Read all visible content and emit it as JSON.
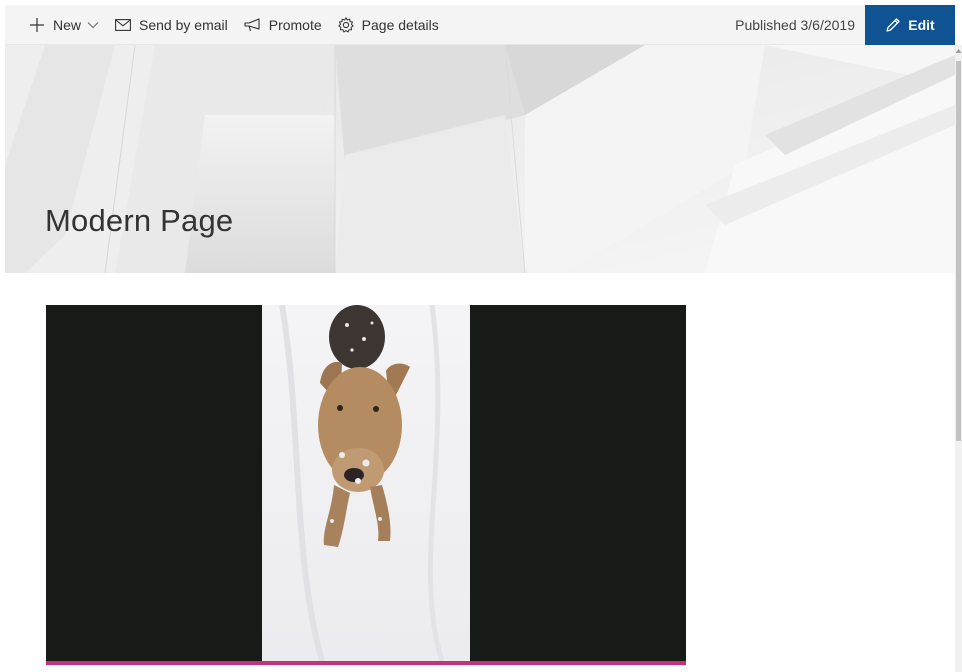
{
  "command_bar": {
    "new_label": "New",
    "send_email_label": "Send by email",
    "promote_label": "Promote",
    "page_details_label": "Page details",
    "published_text": "Published 3/6/2019",
    "edit_label": "Edit"
  },
  "page": {
    "title": "Modern Page"
  },
  "video": {
    "progress_fraction": 1.0
  },
  "colors": {
    "accent": "#0f5392",
    "progress": "#c7307a",
    "video_background": "#161b18"
  },
  "icons": {
    "new": "plus-icon",
    "dropdown": "chevron-down-icon",
    "email": "envelope-icon",
    "promote": "megaphone-icon",
    "details": "gear-icon",
    "edit": "pencil-icon"
  }
}
